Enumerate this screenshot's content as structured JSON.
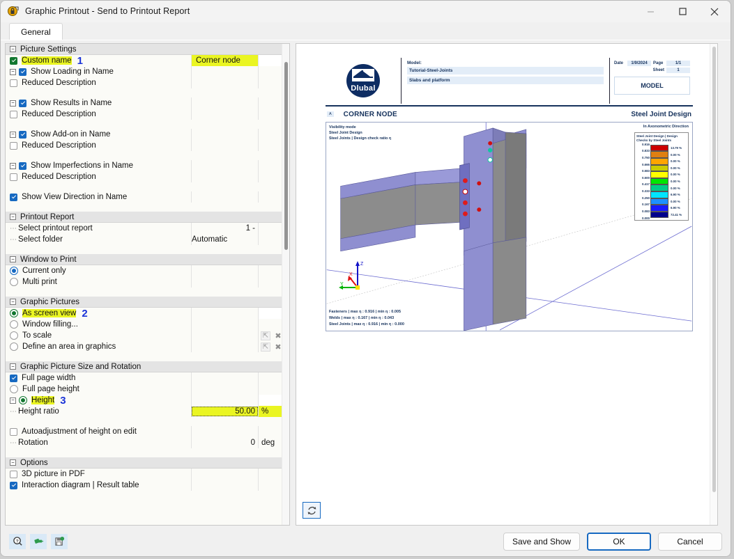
{
  "window": {
    "title": "Graphic Printout - Send to Printout Report",
    "icon": "app-lock-icon",
    "minimize": "–",
    "maximize": "☐",
    "close": "✕"
  },
  "tabs": [
    {
      "label": "General",
      "active": true
    }
  ],
  "tree": {
    "groups": [
      {
        "name": "picture-settings",
        "title": "Picture Settings",
        "rows": [
          {
            "type": "checkbox",
            "state": "on-green",
            "label": "Custom name",
            "value": "Corner node",
            "highlight": true,
            "marker": "1",
            "indent": 2,
            "expander": false
          },
          {
            "type": "checkbox",
            "state": "on",
            "label": "Show Loading in Name",
            "value": "",
            "indent": 1,
            "expander": true
          },
          {
            "type": "checkbox",
            "state": "off",
            "label": "Reduced Description",
            "value": "",
            "indent": 3,
            "expander": false
          },
          {
            "type": "spacer"
          },
          {
            "type": "checkbox",
            "state": "on",
            "label": "Show Results in Name",
            "value": "",
            "indent": 1,
            "expander": true
          },
          {
            "type": "checkbox",
            "state": "off",
            "label": "Reduced Description",
            "value": "",
            "indent": 3,
            "expander": false
          },
          {
            "type": "spacer"
          },
          {
            "type": "checkbox",
            "state": "on",
            "label": "Show Add-on in Name",
            "value": "",
            "indent": 1,
            "expander": true
          },
          {
            "type": "checkbox",
            "state": "off",
            "label": "Reduced Description",
            "value": "",
            "indent": 3,
            "expander": false
          },
          {
            "type": "spacer"
          },
          {
            "type": "checkbox",
            "state": "on",
            "label": "Show Imperfections in Name",
            "value": "",
            "indent": 1,
            "expander": true
          },
          {
            "type": "checkbox",
            "state": "off",
            "label": "Reduced Description",
            "value": "",
            "indent": 3,
            "expander": false
          },
          {
            "type": "spacer"
          },
          {
            "type": "checkbox",
            "state": "on",
            "label": "Show View Direction in Name",
            "value": "",
            "indent": 2,
            "expander": false
          },
          {
            "type": "spacer"
          }
        ]
      },
      {
        "name": "printout-report",
        "title": "Printout Report",
        "rows": [
          {
            "type": "plain",
            "label": "Select printout report",
            "value": "1 -",
            "indent": 2
          },
          {
            "type": "plain",
            "label": "Select folder",
            "value": "Automatic",
            "indent": 2,
            "value_left": true
          },
          {
            "type": "spacer"
          }
        ]
      },
      {
        "name": "window-to-print",
        "title": "Window to Print",
        "rows": [
          {
            "type": "radio",
            "state": "on",
            "label": "Current only",
            "value": "",
            "indent": 2
          },
          {
            "type": "radio",
            "state": "off",
            "label": "Multi print",
            "value": "",
            "indent": 2
          },
          {
            "type": "spacer"
          }
        ]
      },
      {
        "name": "graphic-pictures",
        "title": "Graphic Pictures",
        "rows": [
          {
            "type": "radio",
            "state": "on-green",
            "label": "As screen view",
            "value": "",
            "highlight": true,
            "marker": "2",
            "indent": 2
          },
          {
            "type": "radio",
            "state": "off",
            "label": "Window filling...",
            "value": "",
            "indent": 2
          },
          {
            "type": "radio",
            "state": "off",
            "label": "To scale",
            "value": "",
            "indent": 2,
            "minibuttons": true
          },
          {
            "type": "radio",
            "state": "off",
            "label": "Define an area in graphics",
            "value": "",
            "indent": 2,
            "minibuttons": true
          },
          {
            "type": "spacer"
          }
        ]
      },
      {
        "name": "graphic-picture-size-and-rotation",
        "title": "Graphic Picture Size and Rotation",
        "rows": [
          {
            "type": "checkbox",
            "state": "on",
            "label": "Full page width",
            "value": "",
            "indent": 2
          },
          {
            "type": "radio",
            "state": "off",
            "label": "Full page height",
            "value": "",
            "indent": 2
          },
          {
            "type": "radio",
            "state": "on-green",
            "label": "Height",
            "value": "",
            "highlight": true,
            "marker": "3",
            "indent": 1,
            "expander": true
          },
          {
            "type": "input",
            "label": "Height ratio",
            "value": "50.00",
            "unit": "%",
            "indent": 3,
            "highlight_value": true
          },
          {
            "type": "spacer"
          },
          {
            "type": "checkbox",
            "state": "off",
            "label": "Autoadjustment of height on edit",
            "value": "",
            "indent": 2
          },
          {
            "type": "plain",
            "label": "Rotation",
            "value": "0",
            "unit": "deg",
            "indent": 2
          },
          {
            "type": "spacer"
          }
        ]
      },
      {
        "name": "options",
        "title": "Options",
        "rows": [
          {
            "type": "checkbox",
            "state": "off",
            "label": "3D picture in PDF",
            "value": "",
            "indent": 2
          },
          {
            "type": "checkbox",
            "state": "on",
            "label": "Interaction diagram | Result table",
            "value": "",
            "indent": 2
          }
        ]
      }
    ]
  },
  "preview": {
    "header": {
      "logo_text": "Dlubal",
      "model_caption": "Model:",
      "model_name": "Tutorial-Steel-Joints",
      "model_desc": "Slabs and platform",
      "date_label": "Date",
      "date_value": "1/9/2024",
      "page_label": "Page",
      "page_value": "1/1",
      "sheet_label": "Sheet",
      "sheet_value": "1",
      "section_box": "MODEL"
    },
    "subheader": {
      "badge": "A",
      "title": "CORNER NODE",
      "right_title": "Steel Joint Design"
    },
    "viewport": {
      "top_left_lines": [
        "Visibility mode",
        "Steel Joint Design",
        "Steel Joints | Design check ratio η"
      ],
      "top_right": "In Axonometric Direction",
      "bottom_left_lines": [
        "Fasteners | max η : 0.916 | min η : 0.005",
        "Welds | max η : 0.167 | min η : 0.043",
        "Steel Joints | max η : 0.916 | min η : 0.000"
      ],
      "axis_labels": {
        "x": "X",
        "y": "Y",
        "z": "Z"
      }
    },
    "legend": {
      "title_line1": "Steel Joint Design | Design",
      "title_line2": "Checks by Steel Joints",
      "entries": [
        {
          "tick": "0.916",
          "color": "#cc0000",
          "percent": "13.79 %"
        },
        {
          "tick": "0.833",
          "color": "#df7f11",
          "percent": "0.00 %"
        },
        {
          "tick": "0.750",
          "color": "#ffa500",
          "percent": "0.00 %"
        },
        {
          "tick": "0.666",
          "color": "#cccc00",
          "percent": "0.00 %"
        },
        {
          "tick": "0.583",
          "color": "#ffff00",
          "percent": "0.00 %"
        },
        {
          "tick": "0.500",
          "color": "#00e600",
          "percent": "0.00 %"
        },
        {
          "tick": "0.417",
          "color": "#00cc88",
          "percent": "0.00 %"
        },
        {
          "tick": "0.333",
          "color": "#00e5ff",
          "percent": "6.90 %"
        },
        {
          "tick": "0.250",
          "color": "#1e90ff",
          "percent": "0.00 %"
        },
        {
          "tick": "0.167",
          "color": "#1a1aff",
          "percent": "6.90 %"
        },
        {
          "tick": "0.083",
          "color": "#00008b",
          "percent": "72.41 %"
        }
      ],
      "last_tick": "0.000"
    },
    "refresh_icon": "refresh-icon"
  },
  "footer": {
    "icons": [
      {
        "name": "help-icon",
        "glyph": "?"
      },
      {
        "name": "connection-icon",
        "glyph": "⚯"
      },
      {
        "name": "save-settings-icon",
        "glyph": "⎙"
      }
    ],
    "buttons": {
      "save_and_show": "Save and Show",
      "ok": "OK",
      "cancel": "Cancel"
    }
  }
}
